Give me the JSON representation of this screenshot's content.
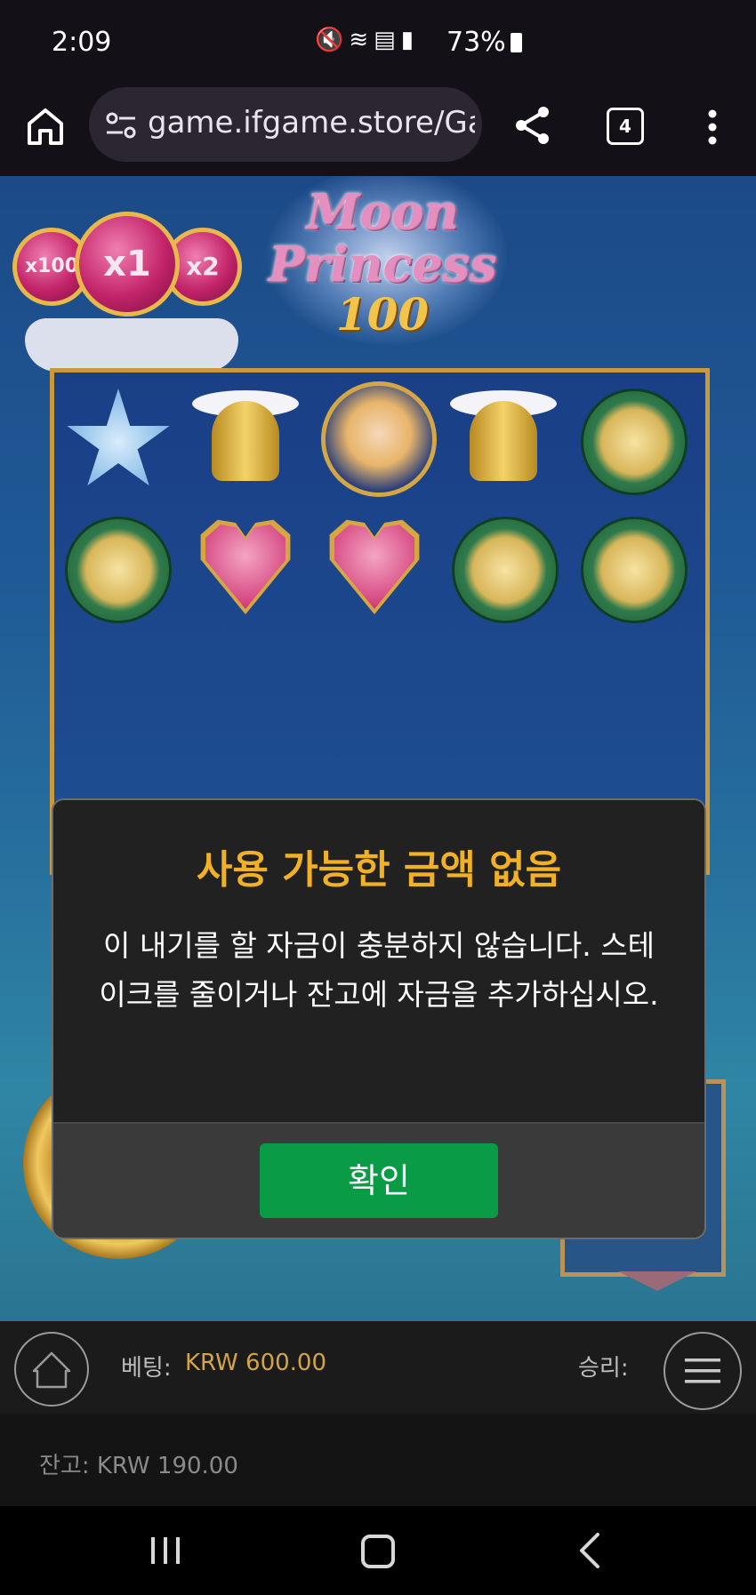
{
  "status_bar": {
    "time": "2:09",
    "icons": [
      "mute-icon",
      "wifi-icon",
      "hd-voice-icon",
      "signal-icon"
    ],
    "battery": "73%"
  },
  "browser": {
    "url": "game.ifgame.store/Ga",
    "tab_count": "4"
  },
  "game": {
    "logo_line1": "Moon",
    "logo_line2": "Princess",
    "logo_line3": "100",
    "multipliers": [
      "x100",
      "x1",
      "x2"
    ],
    "reel_symbols_row1": [
      "star-moon",
      "winged-bell",
      "princess-portrait",
      "winged-bell",
      "green-coin"
    ],
    "reel_symbols_row2": [
      "green-coin",
      "winged-heart",
      "winged-heart",
      "green-coin",
      "green-coin"
    ]
  },
  "dialog": {
    "title": "사용 가능한 금액 없음",
    "message": "이 내기를 할 자금이 충분하지 않습니다. 스테이크를 줄이거나 잔고에 자금을 추가하십시오.",
    "ok_label": "확인"
  },
  "bottom_bar": {
    "bet_label": "베팅:",
    "bet_value": "KRW 600.00",
    "win_label": "승리:",
    "balance": "잔고: KRW 190.00"
  },
  "colors": {
    "dialog_title": "#f0b127",
    "ok_button": "#0a9b47",
    "bet_value": "#d4a548"
  }
}
